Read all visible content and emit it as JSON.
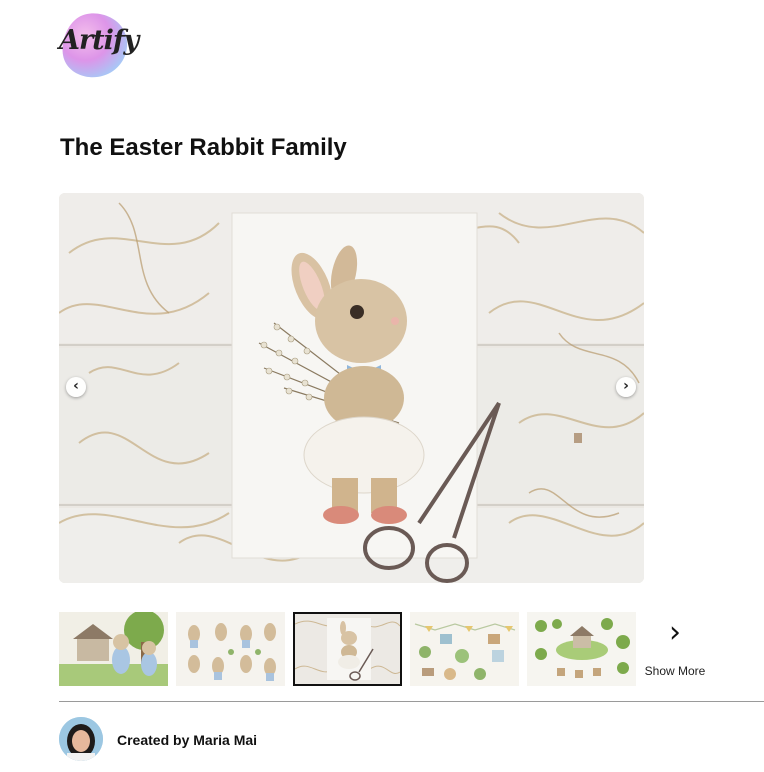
{
  "brand": {
    "logo_text": "Artify"
  },
  "product": {
    "title": "The Easter Rabbit Family"
  },
  "gallery": {
    "prev_icon": "‹",
    "next_icon": "›",
    "thumbnails": [
      {
        "subject": "rabbit family in garden"
      },
      {
        "subject": "rabbit character set"
      },
      {
        "subject": "rabbit with scissors"
      },
      {
        "subject": "garden elements set"
      },
      {
        "subject": "cottage scene elements"
      }
    ],
    "selected_index": 2,
    "show_more_icon": "›",
    "show_more_label": "Show More"
  },
  "creator": {
    "prefix": "Created by",
    "name": "Maria Mai",
    "text": "Created by Maria Mai"
  },
  "colors": {
    "accent_pink": "#e06bd0",
    "accent_blue": "#8fb9f0",
    "text": "#111111"
  }
}
